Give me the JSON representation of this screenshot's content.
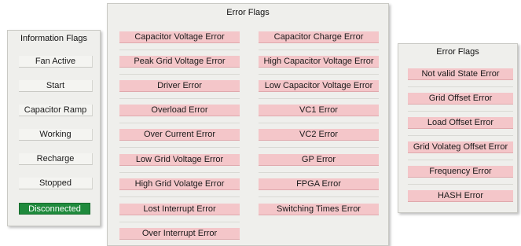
{
  "info_panel": {
    "title": "Information Flags",
    "flags": [
      {
        "label": "Fan Active",
        "state": "off"
      },
      {
        "label": "Start",
        "state": "off"
      },
      {
        "label": "Capacitor Ramp",
        "state": "off"
      },
      {
        "label": "Working",
        "state": "off"
      },
      {
        "label": "Recharge",
        "state": "off"
      },
      {
        "label": "Stopped",
        "state": "off"
      },
      {
        "label": "Disconnected",
        "state": "on"
      }
    ]
  },
  "error_panel_main": {
    "title": "Error Flags",
    "column_left": [
      "Capacitor Voltage Error",
      "Peak Grid Voltage Error",
      "Driver Error",
      "Overload Error",
      "Over Current Error",
      "Low Grid Voltage Error",
      "High Grid Volatge Error",
      "Lost Interrupt Error",
      "Over Interrupt Error"
    ],
    "column_right": [
      "Capacitor Charge Error",
      "High Capacitor Voltage Error",
      "Low Capacitor Voltage Error",
      "VC1 Error",
      "VC2 Error",
      "GP Error",
      "FPGA Error",
      "Switching Times Error"
    ]
  },
  "error_panel_side": {
    "title": "Error Flags",
    "flags": [
      "Not valid State Error",
      "Grid Offset Error",
      "Load Offset Error",
      "Grid Volateg Offset Error",
      "Frequency Error",
      "HASH Error"
    ]
  },
  "colors": {
    "panel_bg": "#efefec",
    "error_flag": "#f4c6c9",
    "active_flag": "#1f8a3c"
  }
}
